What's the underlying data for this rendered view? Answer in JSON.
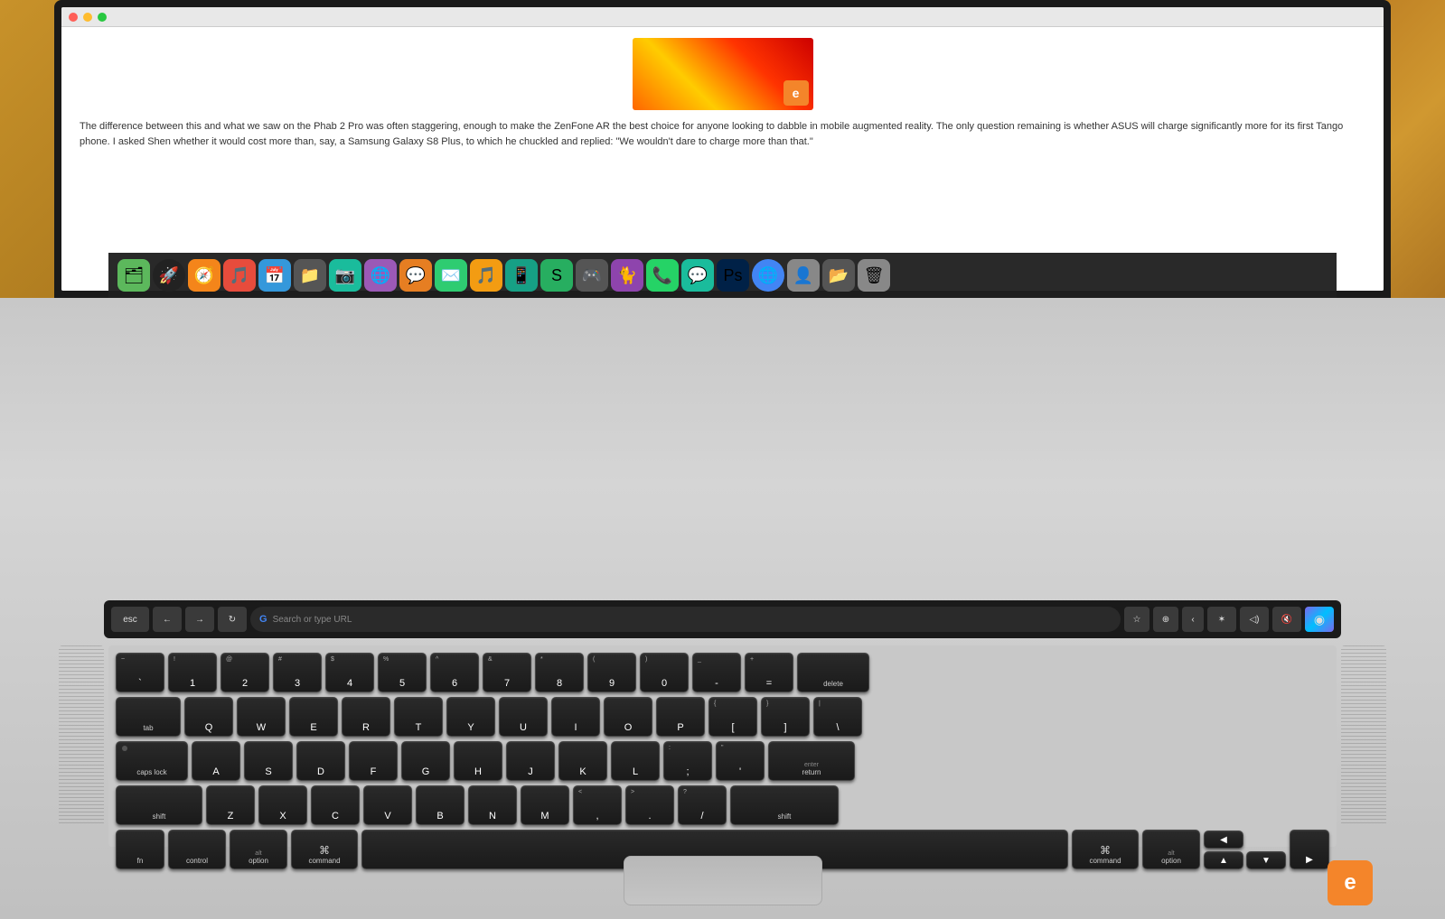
{
  "table": {
    "bg_color": "#8B6914"
  },
  "screen": {
    "article": {
      "text": "The difference between this and what we saw on the Phab 2 Pro was often staggering, enough to make the ZenFone AR the best choice for anyone looking to dabble in mobile augmented reality. The only question remaining is whether ASUS will charge significantly more for its first Tango phone. I asked Shen whether it would cost more than, say, a Samsung Galaxy S8 Plus, to which he chuckled and replied: \"We wouldn't dare to charge more than that.\""
    }
  },
  "touch_bar": {
    "esc_label": "esc",
    "search_placeholder": "Search or type URL",
    "google_label": "G"
  },
  "keyboard": {
    "rows": [
      [
        "~\n`",
        "!\n1",
        "@\n2",
        "#\n3",
        "$\n4",
        "%\n5",
        "^\n6",
        "&\n7",
        "*\n8",
        "(\n9",
        ")\n0",
        "_\n-",
        "+\n=",
        "delete"
      ],
      [
        "tab",
        "Q",
        "W",
        "E",
        "R",
        "T",
        "Y",
        "U",
        "I",
        "O",
        "P",
        "{\n[",
        "}\n]",
        "|\n\\"
      ],
      [
        "caps lock",
        "A",
        "S",
        "D",
        "F",
        "G",
        "H",
        "J",
        "K",
        "L",
        ":\n;",
        "\"\n'",
        "enter\nreturn"
      ],
      [
        "shift",
        "Z",
        "X",
        "C",
        "V",
        "B",
        "N",
        "M",
        "<\n,",
        ">\n.",
        "?\n/",
        "shift"
      ],
      [
        "fn",
        "control",
        "alt\noption",
        "⌘\ncommand",
        "",
        "⌘\ncommand",
        "alt\noption",
        "◀",
        "▲\n▼"
      ]
    ]
  },
  "engadget": {
    "logo_text": "e"
  }
}
